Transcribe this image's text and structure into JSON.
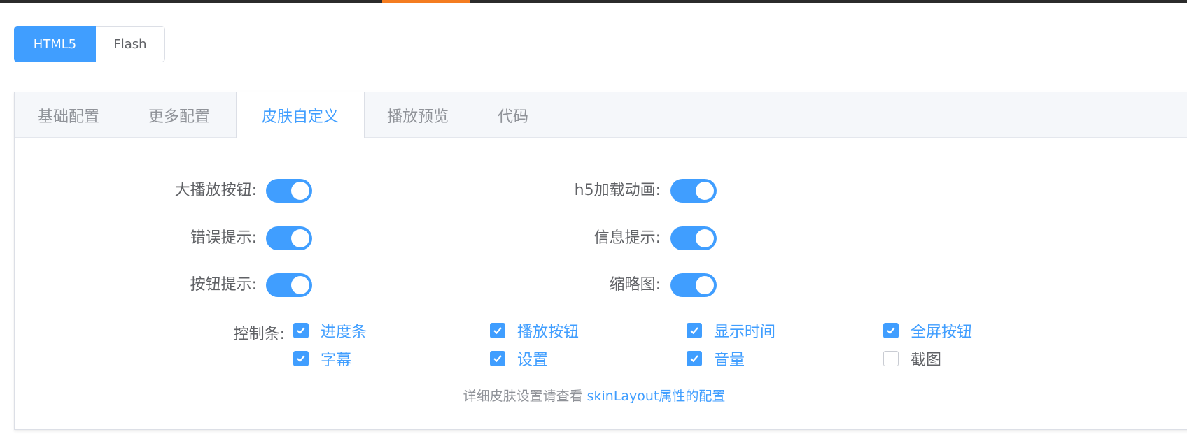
{
  "mode_buttons": {
    "html5": "HTML5",
    "flash": "Flash"
  },
  "tabs": [
    {
      "label": "基础配置",
      "active": false
    },
    {
      "label": "更多配置",
      "active": false
    },
    {
      "label": "皮肤自定义",
      "active": true
    },
    {
      "label": "播放预览",
      "active": false
    },
    {
      "label": "代码",
      "active": false
    }
  ],
  "switches": {
    "big_play_button": {
      "label": "大播放按钮:",
      "on": true
    },
    "h5_loading_animation": {
      "label": "h5加载动画:",
      "on": true
    },
    "error_tip": {
      "label": "错误提示:",
      "on": true
    },
    "info_tip": {
      "label": "信息提示:",
      "on": true
    },
    "button_tip": {
      "label": "按钮提示:",
      "on": true
    },
    "thumbnail": {
      "label": "缩略图:",
      "on": true
    }
  },
  "control_bar": {
    "label": "控制条:",
    "items": [
      {
        "label": "进度条",
        "checked": true
      },
      {
        "label": "播放按钮",
        "checked": true
      },
      {
        "label": "显示时间",
        "checked": true
      },
      {
        "label": "全屏按钮",
        "checked": true
      },
      {
        "label": "字幕",
        "checked": true
      },
      {
        "label": "设置",
        "checked": true
      },
      {
        "label": "音量",
        "checked": true
      },
      {
        "label": "截图",
        "checked": false
      }
    ]
  },
  "footer": {
    "text": "详细皮肤设置请查看 ",
    "link": "skinLayout属性的配置"
  },
  "colors": {
    "accent": "#409eff",
    "top_bar_highlight": "#f47c20"
  }
}
